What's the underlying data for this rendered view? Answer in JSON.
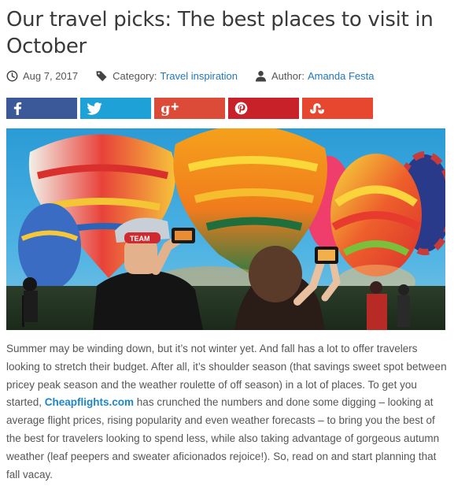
{
  "article": {
    "title": "Our travel picks: The best places to visit in October",
    "date": "Aug 7, 2017",
    "category_label": "Category:",
    "category_value": "Travel inspiration",
    "author_label": "Author:",
    "author_value": "Amanda Festa"
  },
  "share": {
    "buttons": [
      {
        "name": "facebook",
        "icon": "facebook-icon",
        "color": "#3b5898"
      },
      {
        "name": "twitter",
        "icon": "twitter-icon",
        "color": "#1ea1d6"
      },
      {
        "name": "google-plus",
        "icon": "google-plus-icon",
        "color": "#dc4a38"
      },
      {
        "name": "pinterest",
        "icon": "pinterest-icon",
        "color": "#c8212a"
      },
      {
        "name": "stumbleupon",
        "icon": "stumbleupon-icon",
        "color": "#e7462f"
      }
    ]
  },
  "photo": {
    "cap_text": "TEAM"
  },
  "body": {
    "part1": "Summer may be winding down, but it’s not winter yet. And fall has a lot to offer travelers looking to stretch their budget. After all, it’s shoulder season (that savings sweet spot between pricey peak season and the weather roulette of off season) in a lot of places. To get you started, ",
    "brand": "Cheapflights.com",
    "part2": " has crunched the numbers and done some digging – looking at average flight prices, rising popularity and even weather forecasts – to bring you the best of the best for travelers looking to spend less, while also taking advantage of gorgeous autumn weather (leaf peepers and sweater aficionados rejoice!). So, read on and start planning that fall vacay."
  },
  "colors": {
    "link": "#2277b8",
    "brand": "#1d86c8"
  }
}
